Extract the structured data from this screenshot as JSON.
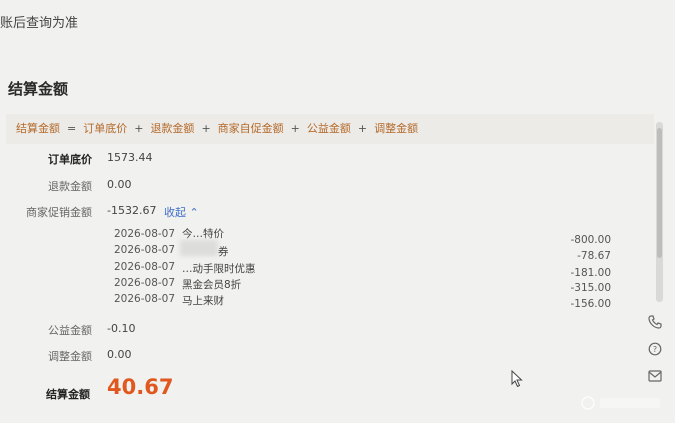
{
  "notice": "账后查询为准",
  "section_title": "结算金额",
  "formula": {
    "result": "结算金额",
    "eq": "=",
    "terms": [
      "订单底价",
      "退款金额",
      "商家自促金额",
      "公益金额",
      "调整金额"
    ],
    "plus": "+"
  },
  "rows": {
    "order_base": {
      "label": "订单底价",
      "value": "1573.44"
    },
    "refund": {
      "label": "退款金额",
      "value": "0.00"
    },
    "promo": {
      "label": "商家促销金额",
      "value": "-1532.67",
      "toggle": "收起"
    },
    "charity": {
      "label": "公益金额",
      "value": "-0.10"
    },
    "adjust": {
      "label": "调整金额",
      "value": "0.00"
    }
  },
  "promo_details": [
    {
      "date": "2026-08-07",
      "name": "今…特价",
      "amount": "-800.00"
    },
    {
      "date": "2026-08-07",
      "name": "券",
      "amount": "-78.67"
    },
    {
      "date": "2026-08-07",
      "name": "…动手限时优惠",
      "amount": "-181.00"
    },
    {
      "date": "2026-08-07",
      "name": "黑金会员8折",
      "amount": "-315.00"
    },
    {
      "date": "2026-08-07",
      "name": "马上来财",
      "amount": "-156.00"
    }
  ],
  "total": {
    "label": "结算金额",
    "value": "40.67"
  },
  "side_icons": [
    "phone-icon",
    "help-icon",
    "mail-icon"
  ],
  "colors": {
    "accent": "#e0581f",
    "link": "#3f6fc9",
    "formula_term": "#b46a2a"
  }
}
